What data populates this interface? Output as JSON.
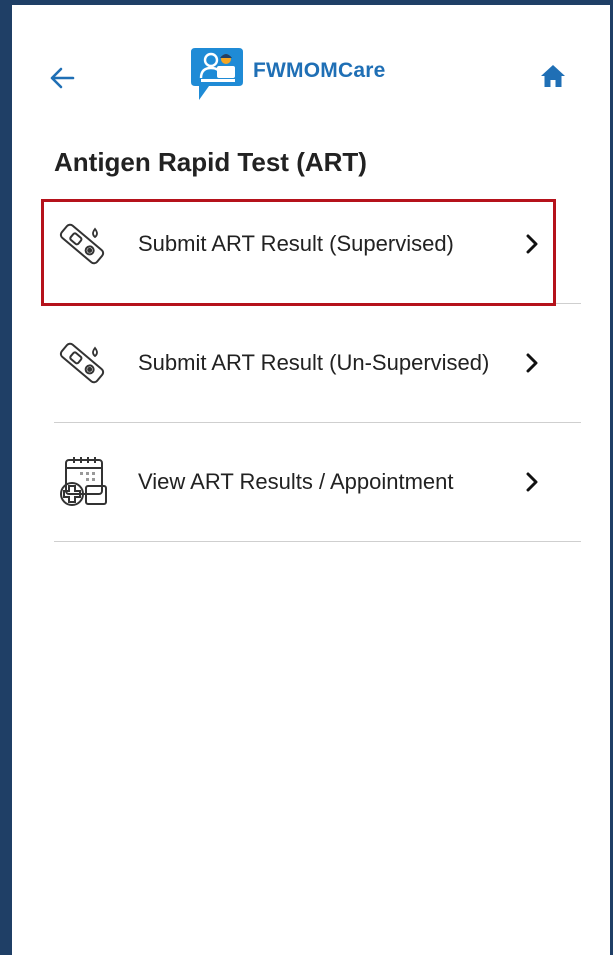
{
  "header": {
    "app_name": "FWMOMCare",
    "back_icon": "arrow-left-icon",
    "home_icon": "home-icon",
    "logo_icon": "fwmomcare-logo",
    "brand_color": "#1f6fb5"
  },
  "page": {
    "title": "Antigen Rapid Test (ART)"
  },
  "menu": {
    "items": [
      {
        "label": "Submit ART Result (Supervised)",
        "icon": "test-kit-icon",
        "highlighted": true
      },
      {
        "label": "Submit ART Result (Un-Supervised)",
        "icon": "test-kit-icon",
        "highlighted": false
      },
      {
        "label": "View ART Results / Appointment",
        "icon": "calendar-medical-icon",
        "highlighted": false
      }
    ]
  },
  "colors": {
    "frame": "#1f3f66",
    "highlight": "#b5121b",
    "text": "#222222",
    "divider": "#cfcfcf"
  }
}
